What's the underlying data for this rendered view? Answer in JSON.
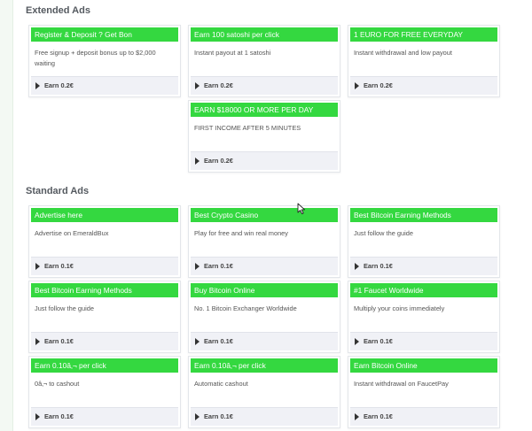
{
  "extended": {
    "title": "Extended Ads",
    "cards": [
      {
        "title": "Register & Deposit ? Get Bon",
        "desc": "Free signup + deposit bonus up to $2,000 waiting",
        "earn": "Earn 0.2€"
      },
      {
        "title": "Earn 100 satoshi per click",
        "desc": "Instant payout at 1 satoshi",
        "earn": "Earn 0.2€"
      },
      {
        "title": "1 EURO FOR FREE EVERYDAY",
        "desc": "Instant withdrawal and low payout",
        "earn": "Earn 0.2€"
      },
      {
        "title": "EARN $18000 OR MORE PER DAY",
        "desc": "FIRST INCOME AFTER 5 MINUTES",
        "earn": "Earn 0.2€"
      }
    ]
  },
  "standard": {
    "title": "Standard Ads",
    "cards": [
      {
        "title": "Advertise here",
        "desc": "Advertise on EmeraldBux",
        "earn": "Earn 0.1€"
      },
      {
        "title": "Best Crypto Casino",
        "desc": "Play for free and win real money",
        "earn": "Earn 0.1€"
      },
      {
        "title": "Best Bitcoin Earning Methods",
        "desc": "Just follow the guide",
        "earn": "Earn 0.1€"
      },
      {
        "title": "Best Bitcoin Earning Methods",
        "desc": "Just follow the guide",
        "earn": "Earn 0.1€"
      },
      {
        "title": "Buy Bitcoin Online",
        "desc": "No. 1 Bitcoin Exchanger Worldwide",
        "earn": "Earn 0.1€"
      },
      {
        "title": "#1 Faucet Worldwide",
        "desc": "Multiply your coins immediately",
        "earn": "Earn 0.1€"
      },
      {
        "title": "Earn 0.10â‚¬ per click",
        "desc": "0â‚¬ to cashout",
        "earn": "Earn 0.1€"
      },
      {
        "title": "Earn 0.10â‚¬ per click",
        "desc": "Automatic cashout",
        "earn": "Earn 0.1€"
      },
      {
        "title": "Earn Bitcoin Online",
        "desc": "Instant withdrawal on FaucetPay",
        "earn": "Earn 0.1€"
      }
    ]
  },
  "colors": {
    "accent": "#34d840",
    "footer": "#f0f1f6"
  }
}
